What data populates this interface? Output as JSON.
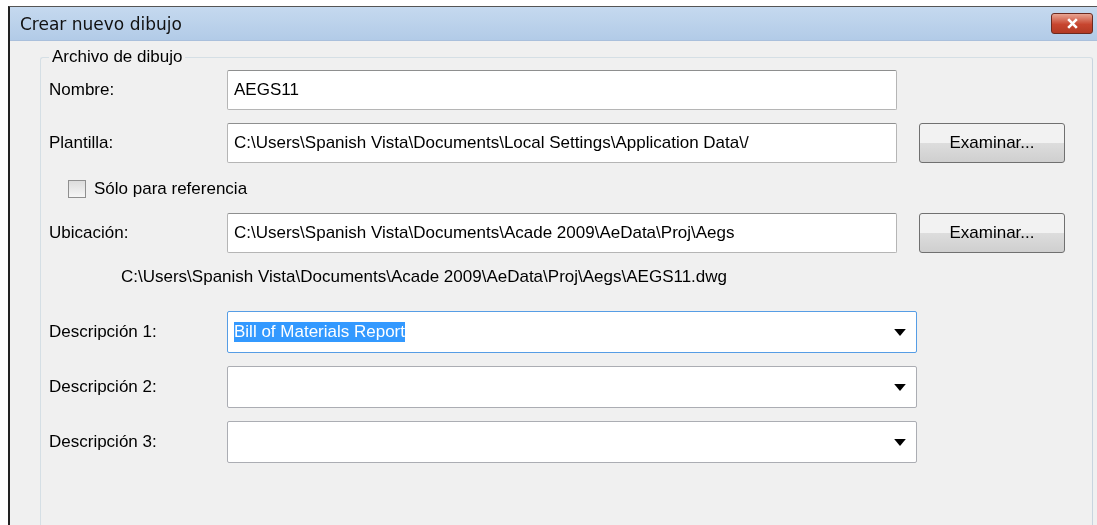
{
  "window": {
    "title": "Crear nuevo dibujo"
  },
  "group": {
    "title": "Archivo de dibujo"
  },
  "fields": [
    {
      "kind": "text",
      "label": "Nombre:",
      "value": "AEGS11"
    },
    {
      "kind": "browse",
      "label": "Plantilla:",
      "value": "C:\\Users\\Spanish Vista\\Documents\\Local Settings\\Application Data\\/",
      "button": "Examinar..."
    },
    {
      "kind": "checkbox",
      "label": "Sólo para referencia",
      "checked": false
    },
    {
      "kind": "browse",
      "label": "Ubicación:",
      "value": "C:\\Users\\Spanish Vista\\Documents\\Acade 2009\\AeData\\Proj\\Aegs",
      "button": "Examinar..."
    },
    {
      "kind": "path",
      "text": "C:\\Users\\Spanish Vista\\Documents\\Acade 2009\\AeData\\Proj\\Aegs\\AEGS11.dwg"
    },
    {
      "kind": "combo",
      "label": "Descripción 1:",
      "value": "Bill of Materials Report",
      "text_selected": true
    },
    {
      "kind": "combo",
      "label": "Descripción 2:",
      "text_selected": false
    },
    {
      "kind": "combo",
      "label": "Descripción 3:",
      "text_selected": false
    }
  ]
}
